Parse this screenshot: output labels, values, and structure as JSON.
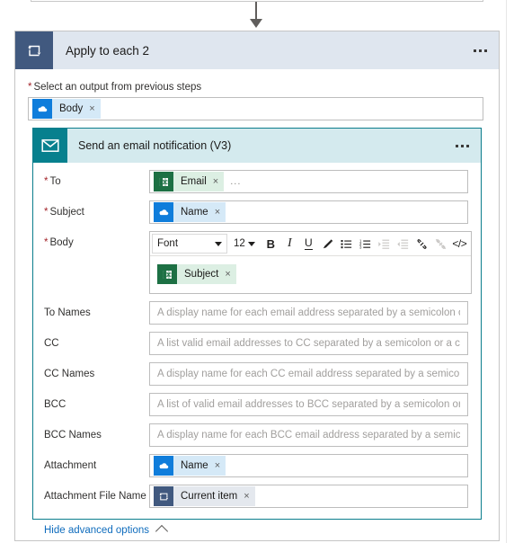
{
  "colors": {
    "loop_icon_bg": "#41597f",
    "loop_header_bg": "#dfe6ef",
    "email_icon_bg": "#07808e",
    "email_header_bg": "#d4eaee",
    "email_card_border": "#0b7d8c",
    "required_asterisk": "#a4262c",
    "link_blue": "#0f6cbd",
    "excel_token": "#1d7044",
    "onedrive_token": "#0f7ddb"
  },
  "loop_card": {
    "title": "Apply to each 2",
    "icon": "loop-icon",
    "menu": "ellipsis-menu",
    "output_field": {
      "label": "Select an output from previous steps",
      "required": true,
      "token": {
        "text": "Body",
        "icon": "onedrive-cloud-icon",
        "remove": "×"
      }
    }
  },
  "email_card": {
    "title": "Send an email notification (V3)",
    "icon": "envelope-icon",
    "menu": "ellipsis-menu",
    "fields": [
      {
        "label": "To",
        "required": true,
        "type": "token",
        "token": {
          "text": "Email",
          "icon": "excel-icon",
          "remove": "×"
        },
        "overflow": "..."
      },
      {
        "label": "Subject",
        "required": true,
        "type": "token",
        "token": {
          "text": "Name",
          "icon": "onedrive-cloud-icon",
          "remove": "×"
        }
      },
      {
        "label": "Body",
        "required": true,
        "type": "richtext",
        "token": {
          "text": "Subject",
          "icon": "excel-icon",
          "remove": "×"
        }
      },
      {
        "label": "To Names",
        "required": false,
        "type": "text",
        "value": "",
        "placeholder": "A display name for each email address separated by a semicolon or a comma."
      },
      {
        "label": "CC",
        "required": false,
        "type": "text",
        "value": "",
        "placeholder": "A list valid email addresses to CC separated by a semicolon or a comma."
      },
      {
        "label": "CC Names",
        "required": false,
        "type": "text",
        "value": "",
        "placeholder": "A display name for each CC email address separated by a semicolon or a comma."
      },
      {
        "label": "BCC",
        "required": false,
        "type": "text",
        "value": "",
        "placeholder": "A list of valid email addresses to BCC separated by a semicolon or a comma."
      },
      {
        "label": "BCC Names",
        "required": false,
        "type": "text",
        "value": "",
        "placeholder": "A display name for each BCC email address separated by a semicolon or a comma."
      },
      {
        "label": "Attachment",
        "required": false,
        "type": "token",
        "token": {
          "text": "Name",
          "icon": "onedrive-cloud-icon",
          "remove": "×"
        }
      },
      {
        "label": "Attachment File Name",
        "required": false,
        "type": "token",
        "token": {
          "text": "Current item",
          "icon": "loop-icon",
          "remove": "×"
        }
      }
    ],
    "editor": {
      "font_family": "Font",
      "font_size": "12",
      "buttons": [
        {
          "name": "bold-button",
          "glyph": "B",
          "enabled": true
        },
        {
          "name": "italic-button",
          "glyph": "I",
          "enabled": true
        },
        {
          "name": "underline-button",
          "glyph": "U",
          "enabled": true
        },
        {
          "name": "text-color-button",
          "glyph": "pen",
          "enabled": true
        },
        {
          "name": "bulleted-list-button",
          "glyph": "bullets",
          "enabled": true
        },
        {
          "name": "numbered-list-button",
          "glyph": "numbers",
          "enabled": true
        },
        {
          "name": "indent-button",
          "glyph": "indent",
          "enabled": false
        },
        {
          "name": "outdent-button",
          "glyph": "outdent",
          "enabled": false
        },
        {
          "name": "link-button",
          "glyph": "link",
          "enabled": true
        },
        {
          "name": "unlink-button",
          "glyph": "unlink",
          "enabled": false
        },
        {
          "name": "code-view-button",
          "glyph": "</>",
          "enabled": true
        }
      ]
    },
    "advanced_toggle": {
      "label": "Hide advanced options",
      "icon": "chevron-up-icon"
    }
  }
}
